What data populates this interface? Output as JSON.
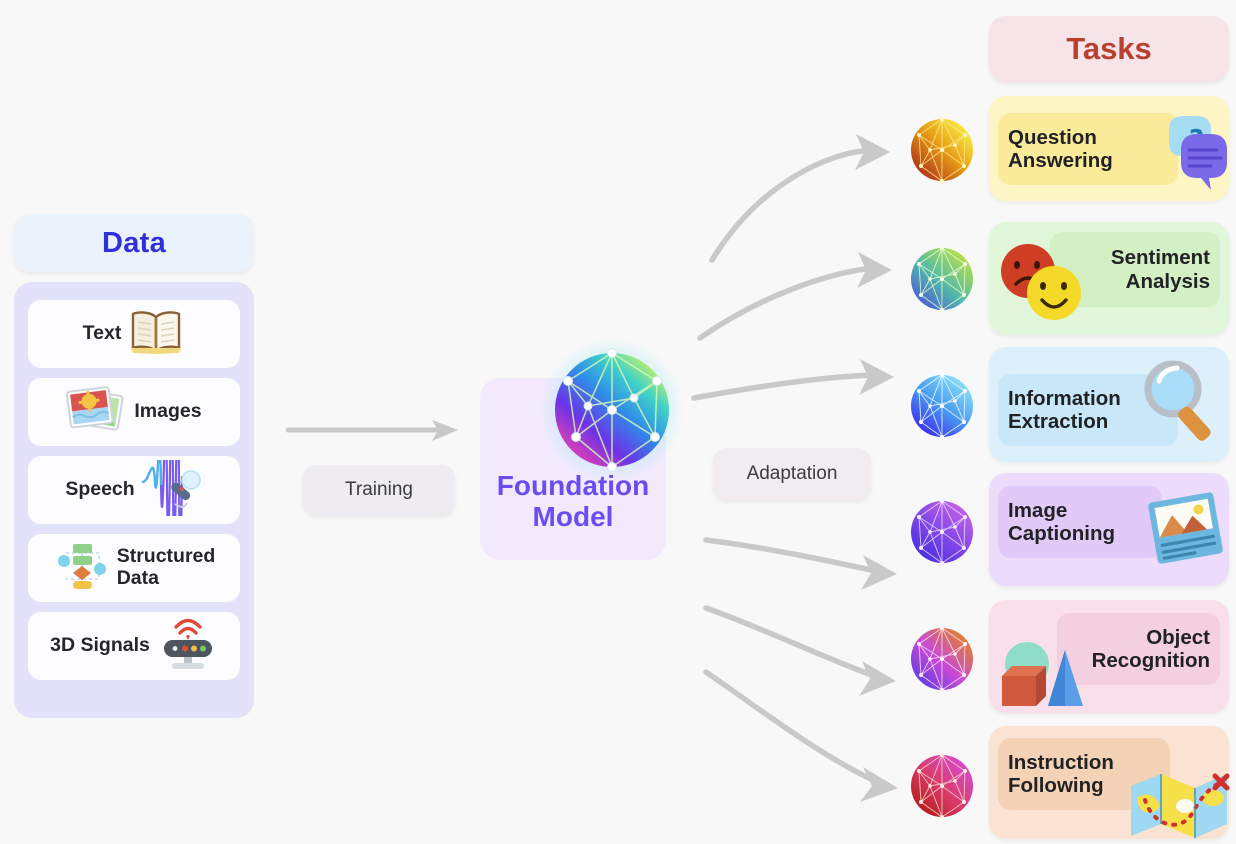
{
  "diagram": {
    "title": "Foundation Model pipeline",
    "background_color": "#f8f8f8"
  },
  "data_section": {
    "header": {
      "label": "Data",
      "bg": "#eaf3fb",
      "text_color": "#3030d8"
    },
    "panel_bg": "#e3e2fb",
    "items": [
      {
        "label": "Text",
        "icon": "open-book-icon",
        "icon_side": "right"
      },
      {
        "label": "Images",
        "icon": "photos-icon",
        "icon_side": "left"
      },
      {
        "label": "Speech",
        "icon": "microphone-wave-icon",
        "icon_side": "right"
      },
      {
        "label": "Structured\nData",
        "icon": "flowchart-icon",
        "icon_side": "left"
      },
      {
        "label": "3D Signals",
        "icon": "sensor-wifi-icon",
        "icon_side": "right"
      }
    ]
  },
  "training": {
    "label": "Training",
    "bg": "#eeecf1",
    "arrow_color": "#c9c9c9",
    "arrow_icon": "straight-arrow-icon"
  },
  "foundation_model": {
    "label": "Foundation\nModel",
    "bg": "#f2e9fd",
    "text_color": "#6a4df2",
    "icon": "network-sphere-icon",
    "sphere_colors": [
      "#5b44f0",
      "#33c8e0",
      "#b0e86a"
    ]
  },
  "adaptation": {
    "label": "Adaptation",
    "bg": "#f0ecf0",
    "arrow_color": "#c9c9c9",
    "arrow_icon": "curved-arrow-icon",
    "arrow_count": 6
  },
  "tasks_section": {
    "header": {
      "label": "Tasks",
      "bg": "#f7e4e9",
      "text_color": "#b8402f"
    },
    "tasks": [
      {
        "label": "Question\nAnswering",
        "card_bg": "#fdf5c4",
        "inner_bg": "#f9eb9a",
        "art": "chat-bubbles-icon",
        "label_side": "left",
        "sphere": "orange-yellow-sphere-icon",
        "sphere_c1": "#f6e03a",
        "sphere_c2": "#c0461a"
      },
      {
        "label": "Sentiment\nAnalysis",
        "card_bg": "#e2f6da",
        "inner_bg": "#d2f0c4",
        "art": "emoji-faces-icon",
        "label_side": "right",
        "sphere": "green-blue-sphere-icon",
        "sphere_c1": "#a8d64a",
        "sphere_c2": "#4a7fd6"
      },
      {
        "label": "Information\nExtraction",
        "card_bg": "#dcf0fb",
        "inner_bg": "#c8e8fa",
        "art": "magnifier-icon",
        "label_side": "left",
        "sphere": "cyan-blue-sphere-icon",
        "sphere_c1": "#6fd2f7",
        "sphere_c2": "#3b2ff0"
      },
      {
        "label": "Image\nCaptioning",
        "card_bg": "#ecdbfa",
        "inner_bg": "#e2caf8",
        "art": "picture-card-icon",
        "label_side": "left",
        "sphere": "violet-purple-sphere-icon",
        "sphere_c1": "#b25ae0",
        "sphere_c2": "#4b2fe0"
      },
      {
        "label": "Object\nRecognition",
        "card_bg": "#f8dfe9",
        "inner_bg": "#f3cfdf",
        "art": "3d-shapes-icon",
        "label_side": "right",
        "sphere": "pink-violet-sphere-icon",
        "sphere_c1": "#e05ad0",
        "sphere_c2": "#d0662a"
      },
      {
        "label": "Instruction\nFollowing",
        "card_bg": "#fae3d2",
        "inner_bg": "#f3d2b6",
        "art": "folded-map-icon",
        "label_side": "left",
        "sphere": "red-magenta-sphere-icon",
        "sphere_c1": "#d93a9c",
        "sphere_c2": "#c02020"
      }
    ]
  }
}
